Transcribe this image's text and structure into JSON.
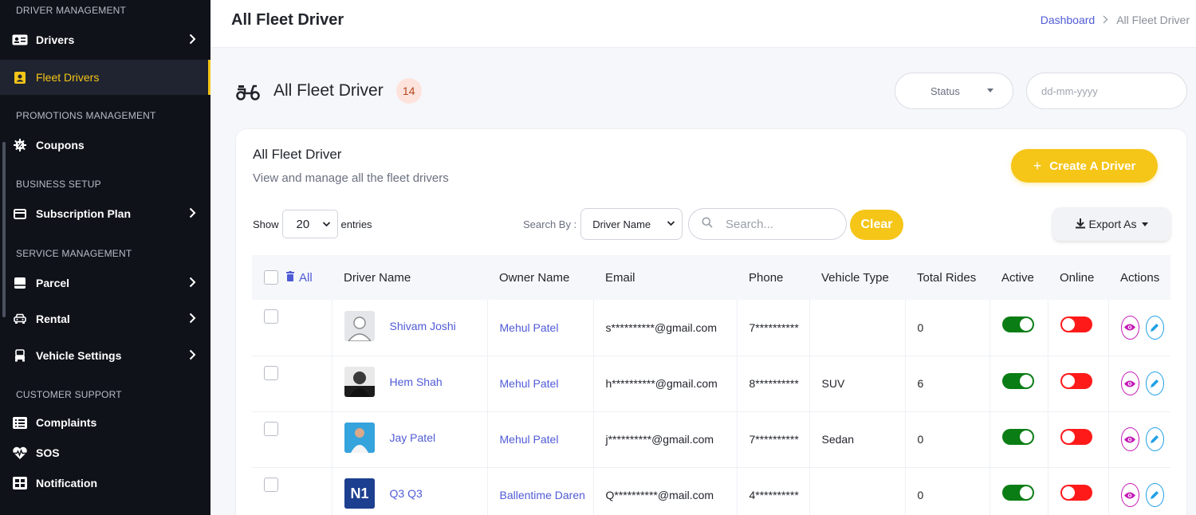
{
  "sidebar": {
    "sections": {
      "driver": "DRIVER MANAGEMENT",
      "promotions": "PROMOTIONS MANAGEMENT",
      "business": "BUSINESS SETUP",
      "service": "SERVICE MANAGEMENT",
      "support": "CUSTOMER SUPPORT"
    },
    "items": {
      "drivers": "Drivers",
      "fleet_drivers": "Fleet Drivers",
      "coupons": "Coupons",
      "subscription_plan": "Subscription Plan",
      "parcel": "Parcel",
      "rental": "Rental",
      "vehicle_settings": "Vehicle Settings",
      "complaints": "Complaints",
      "sos": "SOS",
      "notification": "Notification"
    },
    "active_item": "Fleet Drivers"
  },
  "header": {
    "title": "All Fleet Driver",
    "breadcrumb": {
      "home": "Dashboard",
      "current": "All Fleet Driver"
    }
  },
  "summary": {
    "title": "All Fleet Driver",
    "count": "14",
    "status_placeholder": "Status",
    "date_placeholder": "dd-mm-yyyy"
  },
  "card": {
    "title": "All Fleet Driver",
    "subtitle": "View and manage all the fleet drivers",
    "create_label": "Create A Driver",
    "show_label": "Show",
    "entries_value": "20",
    "entries_label": "entries",
    "search_by_label": "Search By :",
    "search_by_value": "Driver Name",
    "search_placeholder": "Search...",
    "clear_label": "Clear",
    "export_label": "Export As"
  },
  "table": {
    "all_label": "All",
    "columns": [
      "Driver Name",
      "Owner Name",
      "Email",
      "Phone",
      "Vehicle Type",
      "Total Rides",
      "Active",
      "Online",
      "Actions"
    ],
    "rows": [
      {
        "driver": "Shivam Joshi",
        "owner": "Mehul Patel",
        "email": "s**********@gmail.com",
        "phone": "7**********",
        "vehicle": "",
        "rides": "0",
        "active": true,
        "online": false,
        "avatar": "placeholder"
      },
      {
        "driver": "Hem Shah",
        "owner": "Mehul Patel",
        "email": "h**********@gmail.com",
        "phone": "8**********",
        "vehicle": "SUV",
        "rides": "6",
        "active": true,
        "online": false,
        "avatar": "photo-dark"
      },
      {
        "driver": "Jay Patel",
        "owner": "Mehul Patel",
        "email": "j**********@gmail.com",
        "phone": "7**********",
        "vehicle": "Sedan",
        "rides": "0",
        "active": true,
        "online": false,
        "avatar": "photo-light"
      },
      {
        "driver": "Q3 Q3",
        "owner": "Ballentime Daren",
        "email": "Q**********@mail.com",
        "phone": "4**********",
        "vehicle": "",
        "rides": "0",
        "active": true,
        "online": false,
        "avatar": "logo",
        "avatar_text": "N1"
      }
    ]
  },
  "colors": {
    "accent": "#f5c518",
    "link": "#4f5bd5",
    "on": "#0a7d14",
    "off": "#ff1a1a",
    "sidebar": "#0f1219"
  }
}
